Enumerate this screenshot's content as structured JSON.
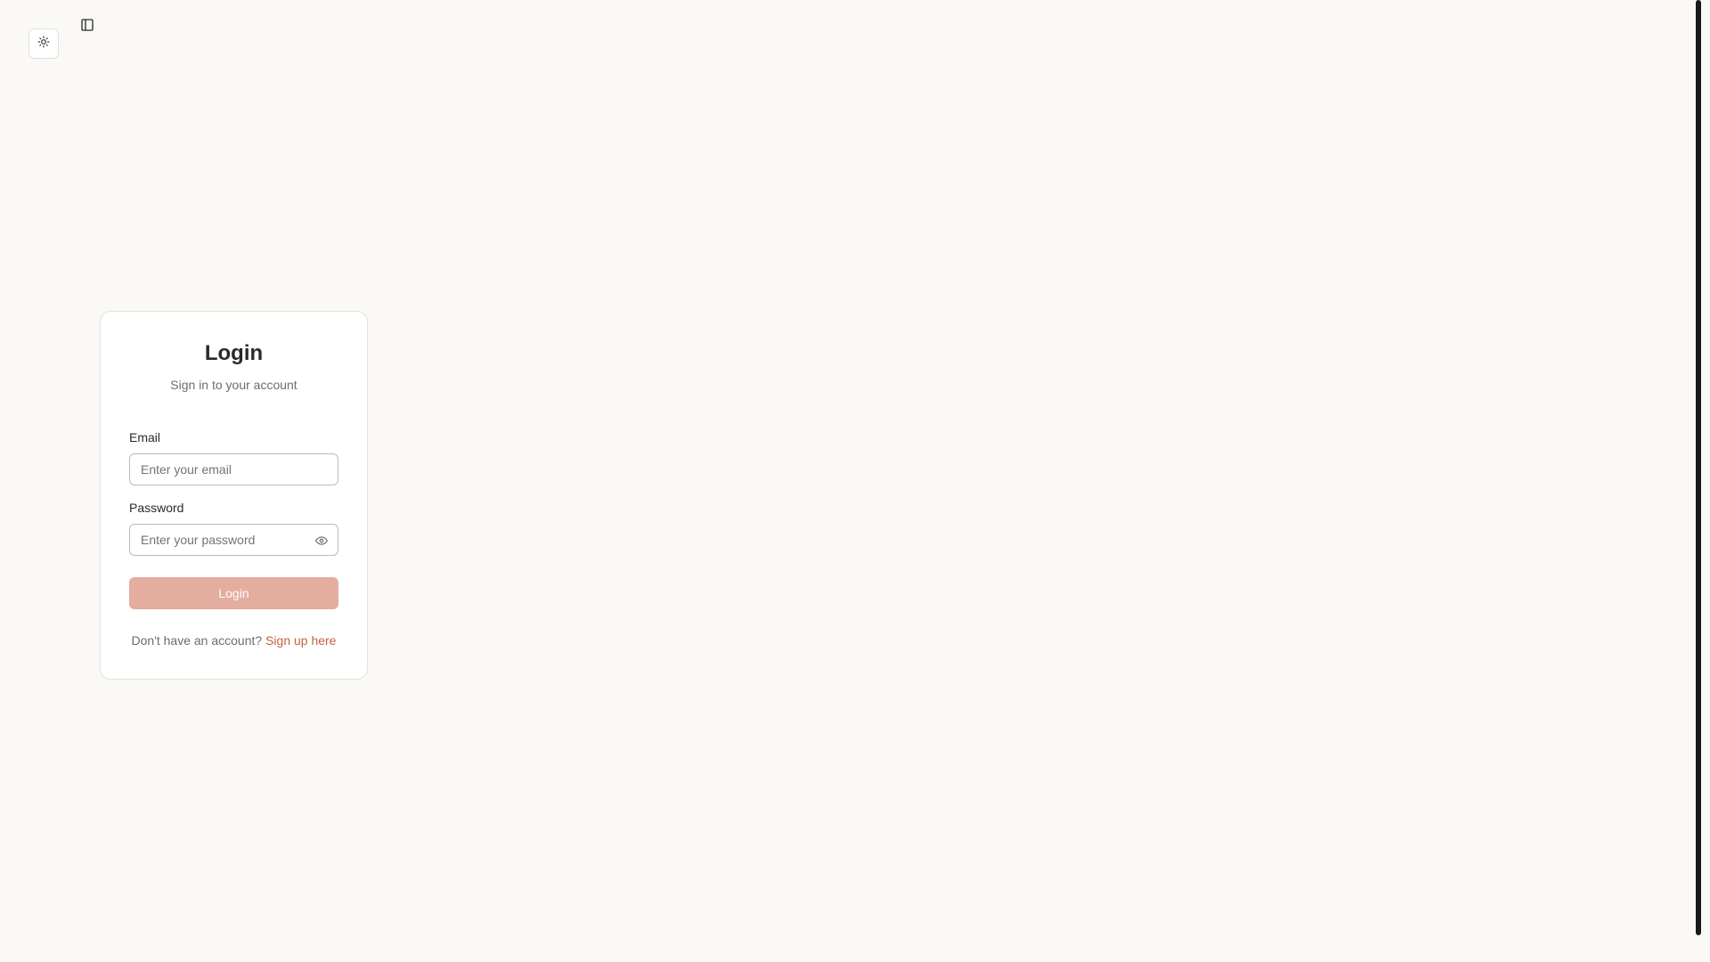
{
  "toolbar": {
    "theme_icon": "sun-icon",
    "sidebar_icon": "sidebar-panel-icon"
  },
  "login": {
    "title": "Login",
    "subtitle": "Sign in to your account",
    "email_label": "Email",
    "email_placeholder": "Enter your email",
    "email_value": "",
    "password_label": "Password",
    "password_placeholder": "Enter your password",
    "password_value": "",
    "password_toggle_icon": "eye-icon",
    "submit_label": "Login",
    "signup_prompt": "Don't have an account?",
    "signup_link": "Sign up here"
  },
  "colors": {
    "background": "#faf9f6",
    "card": "#ffffff",
    "button": "#e3ad9f",
    "link": "#c4623f"
  }
}
